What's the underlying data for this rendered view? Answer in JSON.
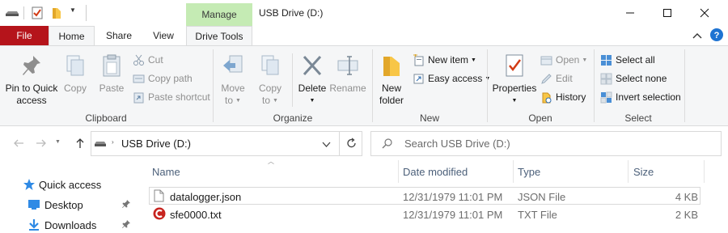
{
  "titlebar": {
    "manage_label": "Manage",
    "window_title": "USB Drive (D:)",
    "icons": [
      "drive-icon",
      "properties-check-icon",
      "new-folder-icon",
      "customize-qat-icon"
    ],
    "controls": [
      "minimize-icon",
      "maximize-icon",
      "close-icon"
    ]
  },
  "tabs": {
    "file": "File",
    "home": "Home",
    "share": "Share",
    "view": "View",
    "drive_tools": "Drive Tools"
  },
  "ribbon": {
    "clipboard": {
      "label": "Clipboard",
      "pin_line1": "Pin to Quick",
      "pin_line2": "access",
      "copy": "Copy",
      "paste": "Paste",
      "cut": "Cut",
      "copy_path": "Copy path",
      "paste_shortcut": "Paste shortcut"
    },
    "organize": {
      "label": "Organize",
      "move_line1": "Move",
      "move_line2": "to",
      "copy_line1": "Copy",
      "copy_line2": "to",
      "delete": "Delete",
      "rename": "Rename"
    },
    "new": {
      "label": "New",
      "new_folder_line1": "New",
      "new_folder_line2": "folder",
      "new_item": "New item",
      "easy_access": "Easy access"
    },
    "open": {
      "label": "Open",
      "properties": "Properties",
      "open": "Open",
      "edit": "Edit",
      "history": "History"
    },
    "select": {
      "label": "Select",
      "select_all": "Select all",
      "select_none": "Select none",
      "invert_selection": "Invert selection"
    }
  },
  "navbar": {
    "address": "USB Drive (D:)",
    "search_placeholder": "Search USB Drive (D:)"
  },
  "navpane": {
    "items": [
      {
        "label": "Quick access",
        "icon": "star-icon"
      },
      {
        "label": "Desktop",
        "icon": "desktop-icon",
        "pinned": true
      },
      {
        "label": "Downloads",
        "icon": "download-arrow-icon",
        "pinned": true
      }
    ]
  },
  "filelist": {
    "columns": [
      "Name",
      "Date modified",
      "Type",
      "Size"
    ],
    "rows": [
      {
        "name": "datalogger.json",
        "date": "12/31/1979 11:01 PM",
        "type": "JSON File",
        "size": "4 KB",
        "icon": "document-icon"
      },
      {
        "name": "sfe0000.txt",
        "date": "12/31/1979 11:01 PM",
        "type": "TXT File",
        "size": "2 KB",
        "icon": "app-file-icon"
      }
    ]
  },
  "colors": {
    "file_tab": "#b5141b",
    "manage_tab": "#c5ebb4",
    "accent": "#1e73d2"
  }
}
